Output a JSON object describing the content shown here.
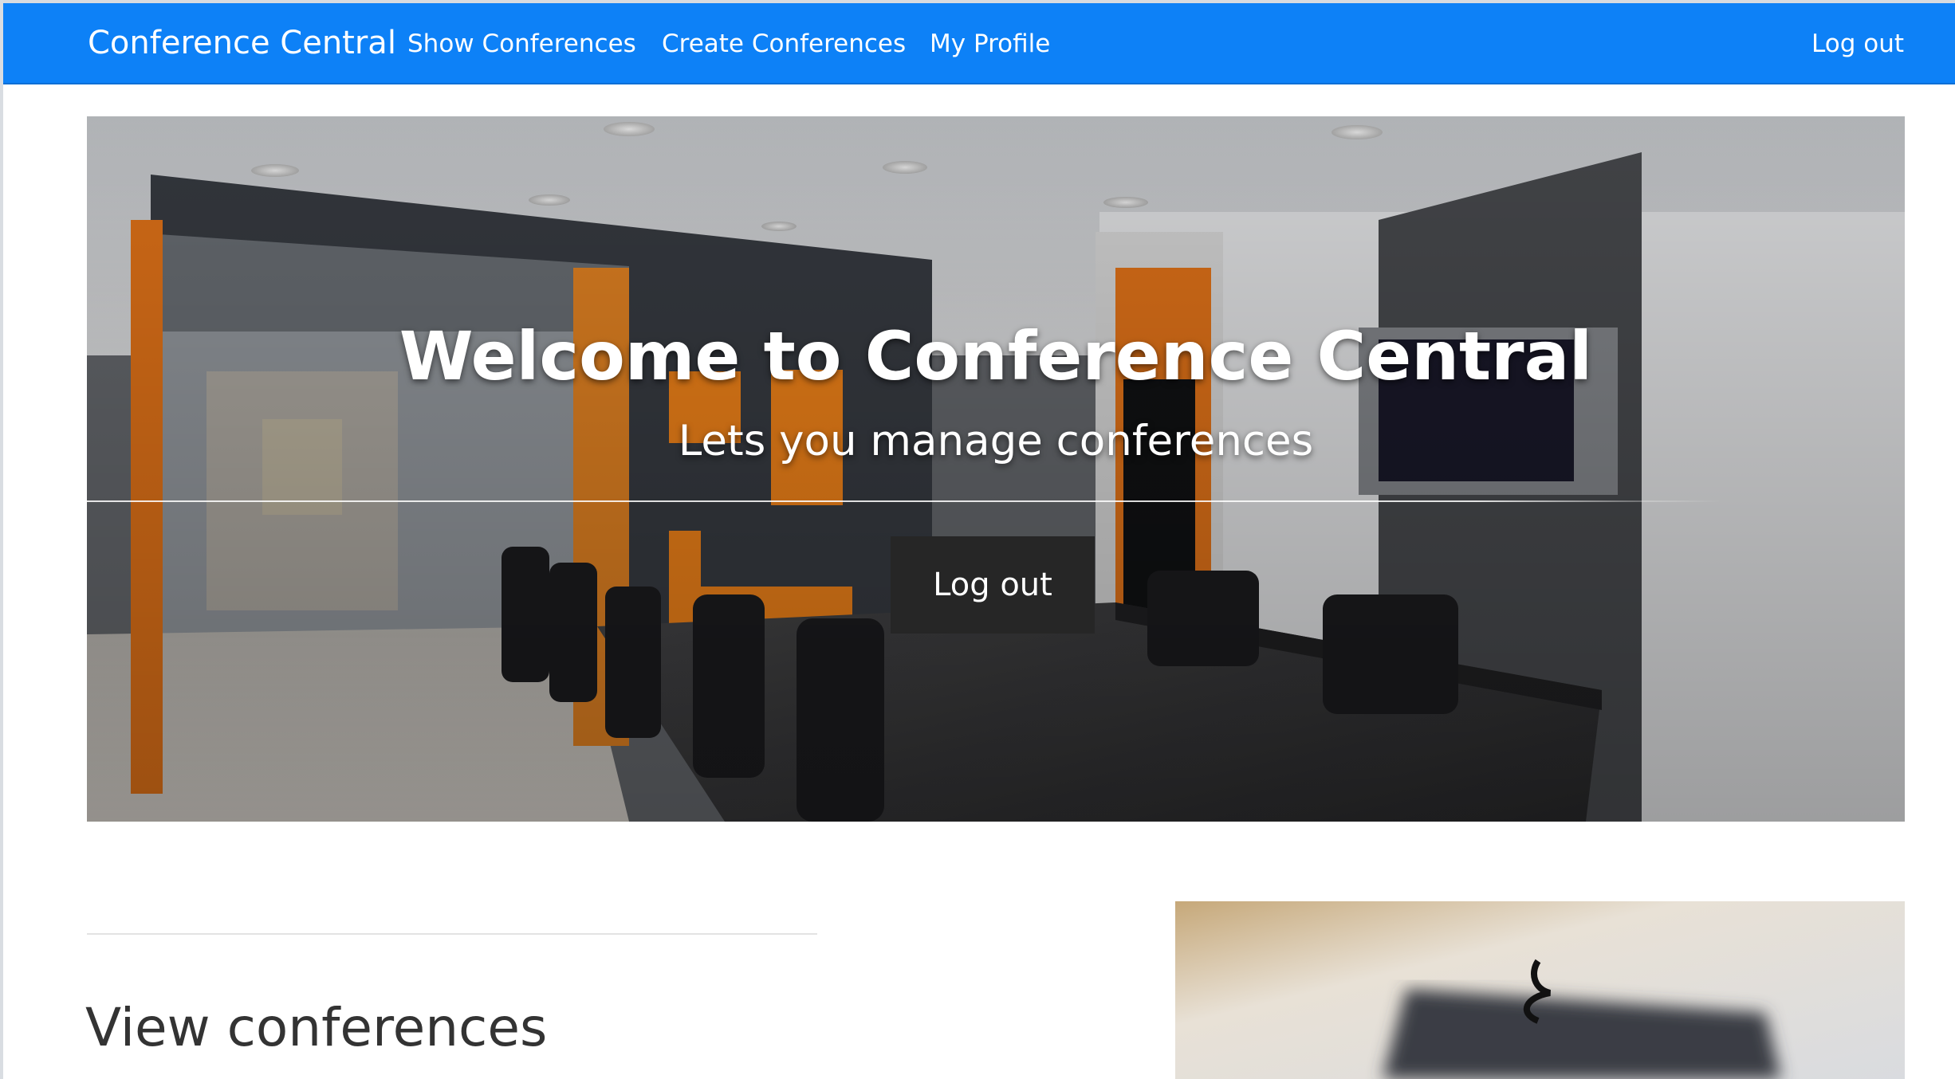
{
  "navbar": {
    "brand": "Conference Central",
    "links": [
      "Show Conferences",
      "Create Conferences",
      "My Profile"
    ],
    "logout": "Log out",
    "color": "#0d81f7"
  },
  "hero": {
    "title": "Welcome to Conference Central",
    "subtitle": "Lets you manage conferences",
    "button_label": "Log out",
    "button_color": "#262626"
  },
  "content": {
    "section_title": "View conferences"
  }
}
